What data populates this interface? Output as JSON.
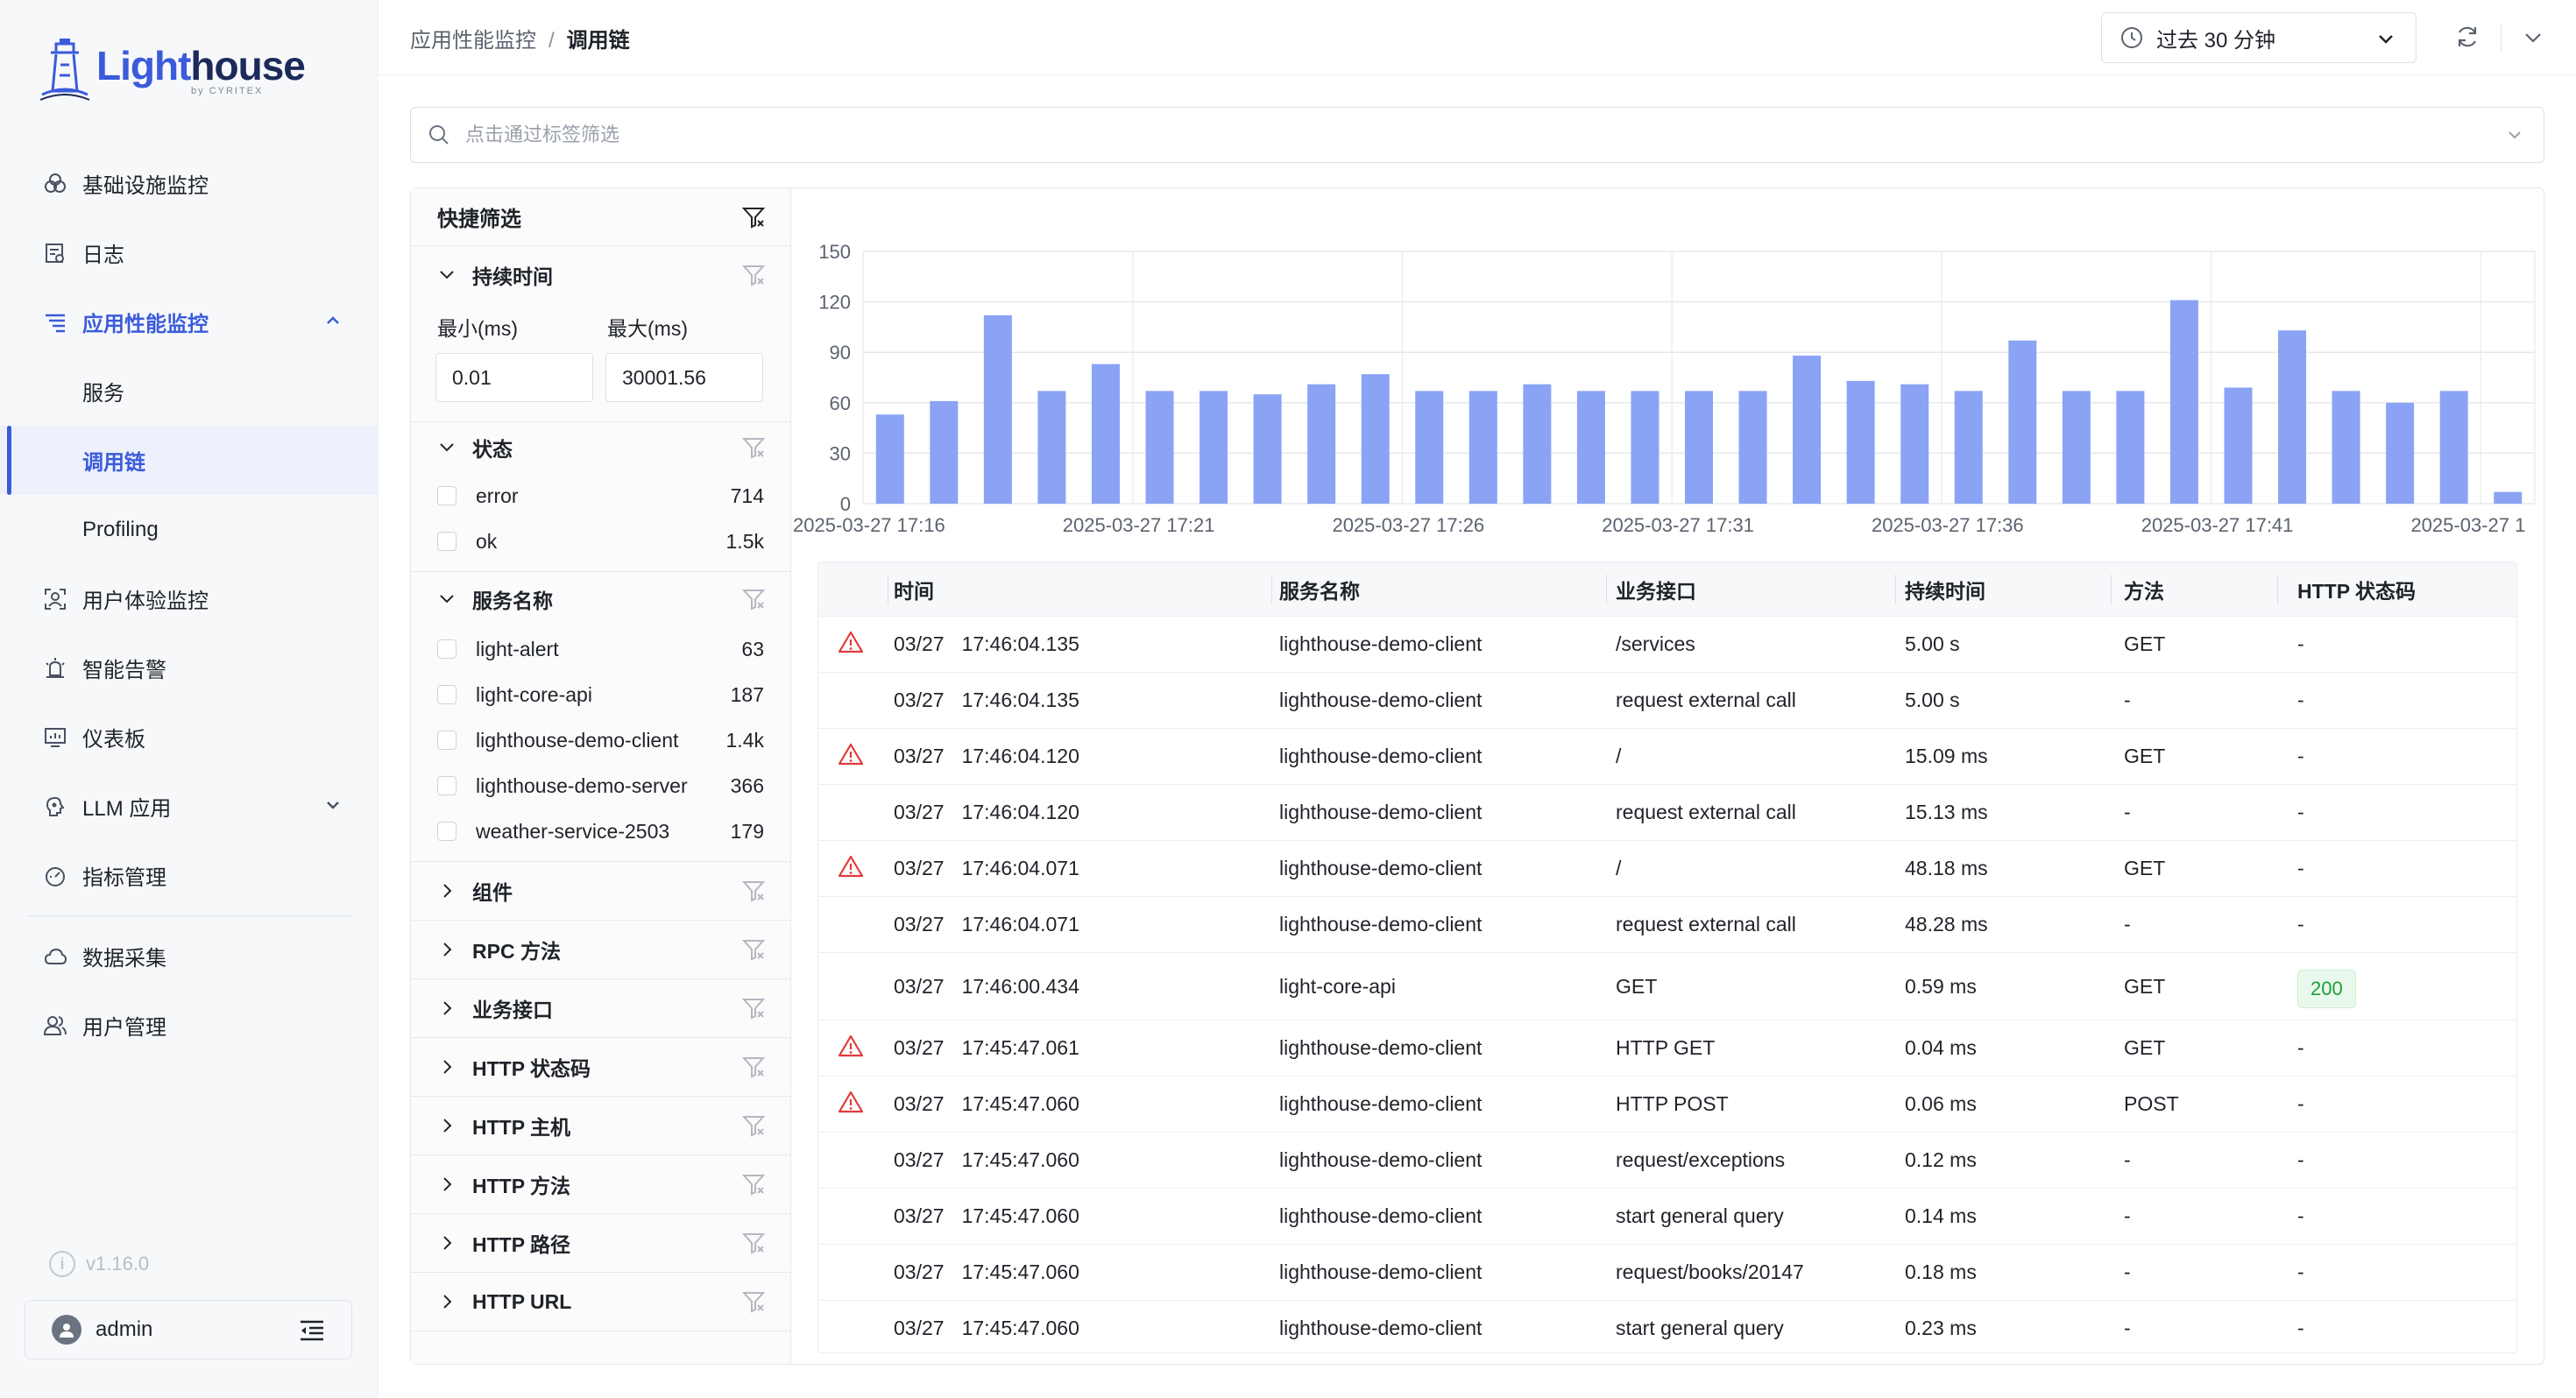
{
  "app": {
    "logo_light": "Light",
    "logo_house": "house",
    "logo_sub": "by CYRITEX"
  },
  "sidebar": {
    "items": [
      {
        "label": "基础设施监控",
        "icon": "infrastructure-icon"
      },
      {
        "label": "日志",
        "icon": "log-icon"
      },
      {
        "label": "应用性能监控",
        "icon": "apm-icon",
        "expanded": true
      },
      {
        "label": "服务",
        "sub": true
      },
      {
        "label": "调用链",
        "sub": true,
        "selected": true
      },
      {
        "label": "Profiling",
        "sub": true
      },
      {
        "label": "用户体验监控",
        "icon": "user-experience-icon"
      },
      {
        "label": "智能告警",
        "icon": "alert-icon"
      },
      {
        "label": "仪表板",
        "icon": "dashboard-icon"
      },
      {
        "label": "LLM 应用",
        "icon": "llm-icon",
        "collapsed": true
      },
      {
        "label": "指标管理",
        "icon": "metrics-icon"
      },
      {
        "label": "数据采集",
        "icon": "data-collection-icon"
      },
      {
        "label": "用户管理",
        "icon": "user-management-icon"
      }
    ],
    "version": "v1.16.0",
    "user": "admin"
  },
  "header": {
    "breadcrumb_parent": "应用性能监控",
    "breadcrumb_sep": "/",
    "breadcrumb_current": "调用链",
    "time_range": "过去 30 分钟"
  },
  "search": {
    "placeholder": "点击通过标签筛选"
  },
  "filters": {
    "title": "快捷筛选",
    "duration": {
      "title": "持续时间",
      "min_label": "最小(ms)",
      "max_label": "最大(ms)",
      "min_value": "0.01",
      "max_value": "30001.56"
    },
    "status": {
      "title": "状态",
      "options": [
        {
          "label": "error",
          "count": "714"
        },
        {
          "label": "ok",
          "count": "1.5k"
        }
      ]
    },
    "service": {
      "title": "服务名称",
      "options": [
        {
          "label": "light-alert",
          "count": "63"
        },
        {
          "label": "light-core-api",
          "count": "187"
        },
        {
          "label": "lighthouse-demo-client",
          "count": "1.4k"
        },
        {
          "label": "lighthouse-demo-server",
          "count": "366"
        },
        {
          "label": "weather-service-2503",
          "count": "179"
        }
      ]
    },
    "collapsed": [
      "组件",
      "RPC 方法",
      "业务接口",
      "HTTP 状态码",
      "HTTP 主机",
      "HTTP 方法",
      "HTTP 路径",
      "HTTP URL"
    ]
  },
  "chart_data": {
    "type": "bar",
    "y_ticks": [
      0,
      30,
      60,
      90,
      120,
      150
    ],
    "ylim": [
      0,
      150
    ],
    "x_tick_labels": [
      "2025-03-27 17:16",
      "2025-03-27 17:21",
      "2025-03-27 17:26",
      "2025-03-27 17:31",
      "2025-03-27 17:36",
      "2025-03-27 17:41",
      "2025-03-27 1"
    ],
    "values": [
      53,
      61,
      112,
      67,
      83,
      67,
      67,
      65,
      71,
      77,
      67,
      67,
      71,
      67,
      67,
      67,
      67,
      88,
      73,
      71,
      67,
      97,
      67,
      67,
      121,
      69,
      103,
      67,
      60,
      67,
      7
    ],
    "bar_color": "#8aa3f5",
    "grid": true
  },
  "table": {
    "columns": [
      "时间",
      "服务名称",
      "业务接口",
      "持续时间",
      "方法",
      "HTTP 状态码"
    ],
    "rows": [
      {
        "error": true,
        "date": "03/27",
        "time": "17:46:04.135",
        "service": "lighthouse-demo-client",
        "endpoint": "/services",
        "duration": "5.00 s",
        "method": "GET",
        "status": "-"
      },
      {
        "error": false,
        "date": "03/27",
        "time": "17:46:04.135",
        "service": "lighthouse-demo-client",
        "endpoint": "request external call",
        "duration": "5.00 s",
        "method": "-",
        "status": "-"
      },
      {
        "error": true,
        "date": "03/27",
        "time": "17:46:04.120",
        "service": "lighthouse-demo-client",
        "endpoint": "/",
        "duration": "15.09 ms",
        "method": "GET",
        "status": "-"
      },
      {
        "error": false,
        "date": "03/27",
        "time": "17:46:04.120",
        "service": "lighthouse-demo-client",
        "endpoint": "request external call",
        "duration": "15.13 ms",
        "method": "-",
        "status": "-"
      },
      {
        "error": true,
        "date": "03/27",
        "time": "17:46:04.071",
        "service": "lighthouse-demo-client",
        "endpoint": "/",
        "duration": "48.18 ms",
        "method": "GET",
        "status": "-"
      },
      {
        "error": false,
        "date": "03/27",
        "time": "17:46:04.071",
        "service": "lighthouse-demo-client",
        "endpoint": "request external call",
        "duration": "48.28 ms",
        "method": "-",
        "status": "-"
      },
      {
        "error": false,
        "date": "03/27",
        "time": "17:46:00.434",
        "service": "light-core-api",
        "endpoint": "GET",
        "duration": "0.59 ms",
        "method": "GET",
        "status": "200",
        "status_badge": true
      },
      {
        "error": true,
        "date": "03/27",
        "time": "17:45:47.061",
        "service": "lighthouse-demo-client",
        "endpoint": "HTTP GET",
        "duration": "0.04 ms",
        "method": "GET",
        "status": "-"
      },
      {
        "error": true,
        "date": "03/27",
        "time": "17:45:47.060",
        "service": "lighthouse-demo-client",
        "endpoint": "HTTP POST",
        "duration": "0.06 ms",
        "method": "POST",
        "status": "-"
      },
      {
        "error": false,
        "date": "03/27",
        "time": "17:45:47.060",
        "service": "lighthouse-demo-client",
        "endpoint": "request/exceptions",
        "duration": "0.12 ms",
        "method": "-",
        "status": "-"
      },
      {
        "error": false,
        "date": "03/27",
        "time": "17:45:47.060",
        "service": "lighthouse-demo-client",
        "endpoint": "start general query",
        "duration": "0.14 ms",
        "method": "-",
        "status": "-"
      },
      {
        "error": false,
        "date": "03/27",
        "time": "17:45:47.060",
        "service": "lighthouse-demo-client",
        "endpoint": "request/books/20147",
        "duration": "0.18 ms",
        "method": "-",
        "status": "-"
      },
      {
        "error": false,
        "date": "03/27",
        "time": "17:45:47.060",
        "service": "lighthouse-demo-client",
        "endpoint": "start general query",
        "duration": "0.23 ms",
        "method": "-",
        "status": "-"
      }
    ]
  },
  "colors": {
    "accent": "#3b5bdb",
    "error": "#e03b3b",
    "success": "#1f9d3a"
  }
}
